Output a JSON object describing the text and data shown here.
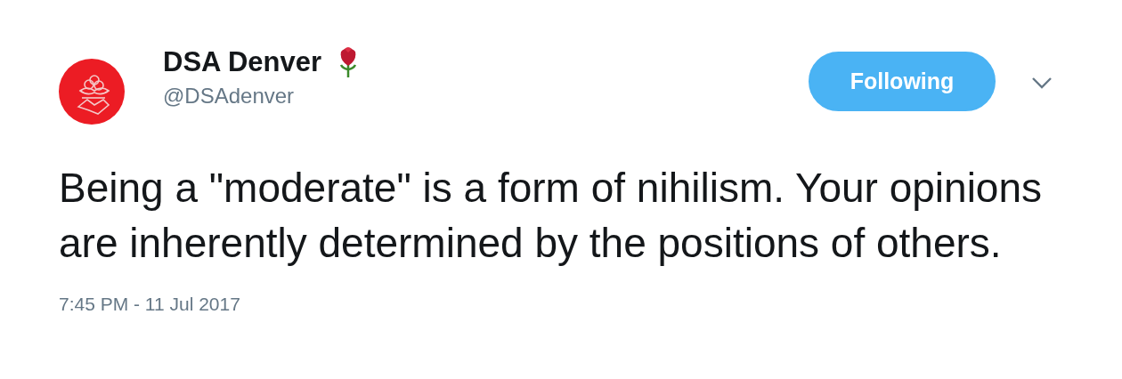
{
  "author": {
    "name": "DSA Denver",
    "handle": "@DSAdenver"
  },
  "follow_button": {
    "label": "Following",
    "selected": true
  },
  "text": "Being a \"moderate\" is a form of nihilism. Your opinions are inherently determined by the positions of others.",
  "timestamp": "7:45 PM - 11 Jul 2017"
}
